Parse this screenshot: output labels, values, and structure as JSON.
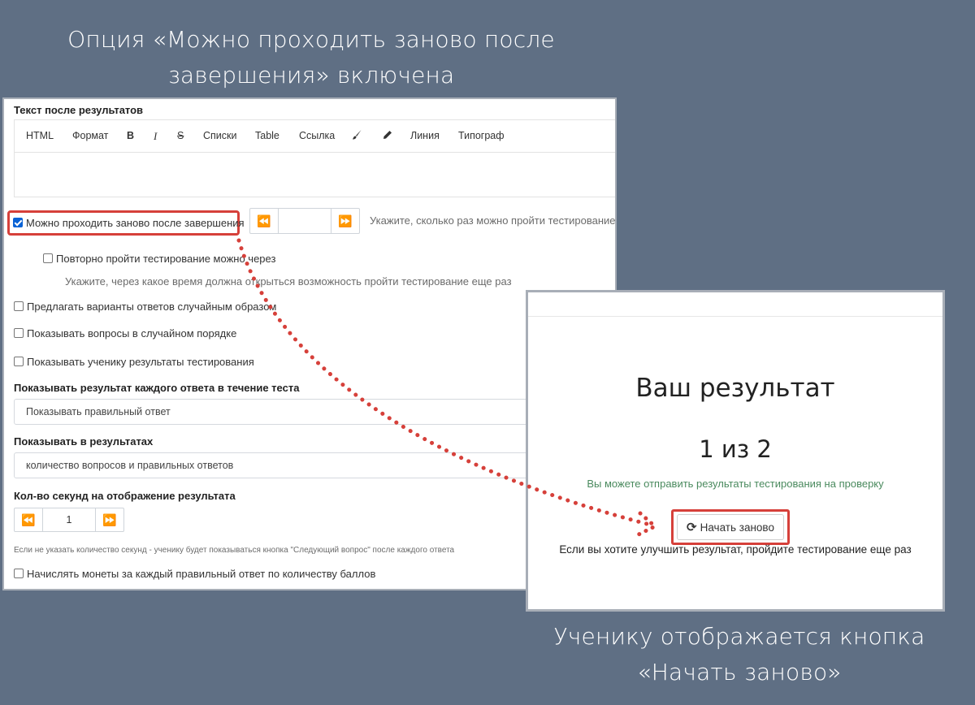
{
  "captions": {
    "top_line1": "Опция «Можно проходить заново после",
    "top_line2": "завершения» включена",
    "bottom_line1": "Ученику отображается кнопка",
    "bottom_line2": "«Начать заново»"
  },
  "colors": {
    "background": "#5f6f84",
    "highlight": "#d6403a",
    "success_text": "#4a8a5e",
    "checkbox_checked": "#0a63d6"
  },
  "settings": {
    "text_after_results_label": "Текст после результатов",
    "editor_toolbar": [
      "HTML",
      "Формат",
      "B",
      "I",
      "S",
      "Списки",
      "Table",
      "Ссылка",
      "brush-icon",
      "pencil-icon",
      "Линия",
      "Типограф"
    ],
    "retake": {
      "label": "Можно проходить заново после завершения",
      "checked": true,
      "count_value": "",
      "hint": "Укажите, сколько раз можно пройти тестирование"
    },
    "retake_after": {
      "label": "Повторно пройти тестирование можно через",
      "checked": false,
      "hint": "Укажите, через какое время должна открыться возможность пройти тестирование еще раз"
    },
    "random_answers": {
      "label": "Предлагать варианты ответов случайным образом",
      "checked": false
    },
    "random_questions": {
      "label": "Показывать вопросы в случайном порядке",
      "checked": false
    },
    "show_results": {
      "label": "Показывать ученику результаты тестирования",
      "checked": false
    },
    "show_each_answer": {
      "label": "Показывать результат каждого ответа в течение теста",
      "value": "Показывать правильный ответ"
    },
    "show_in_results": {
      "label": "Показывать в результатах",
      "value": "количество вопросов и правильных ответов"
    },
    "seconds": {
      "label": "Кол-во секунд на отображение результата",
      "value": "1",
      "hint": "Если не указать количество секунд - ученику будет показываться кнопка \"Следующий вопрос\" после каждого ответа"
    },
    "coins": {
      "label": "Начислять монеты за каждый правильный ответ по количеству баллов",
      "checked": false
    }
  },
  "result": {
    "title": "Ваш результат",
    "score": "1 из 2",
    "send_text": "Вы можете отправить результаты тестирования на проверку",
    "restart_label": "Начать заново",
    "improve_text": "Если вы хотите улучшить результат, пройдите тестирование еще раз"
  }
}
